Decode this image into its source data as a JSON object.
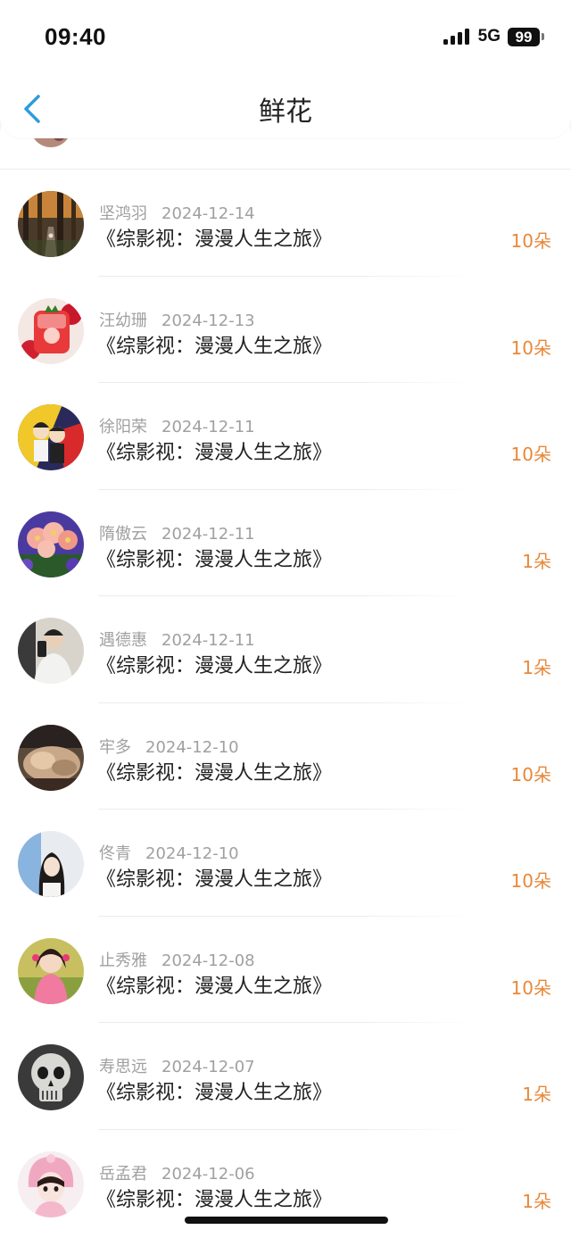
{
  "status_bar": {
    "time": "09:40",
    "network": "5G",
    "battery": "99"
  },
  "header": {
    "title": "鲜花",
    "back_icon": "chevron-left-icon",
    "accent_color": "#2d9cdb"
  },
  "colors": {
    "amount": "#e8883a",
    "meta": "#a0a0a0",
    "title": "#222222"
  },
  "records": [
    {
      "name": "坚鸿羽",
      "date": "2024-12-14",
      "book": "《综影视：漫漫人生之旅》",
      "amount": "10朵",
      "avatar": "forest-avatar"
    },
    {
      "name": "汪幼珊",
      "date": "2024-12-13",
      "book": "《综影视：漫漫人生之旅》",
      "amount": "10朵",
      "avatar": "strawberry-drink-avatar"
    },
    {
      "name": "徐阳荣",
      "date": "2024-12-11",
      "book": "《综影视：漫漫人生之旅》",
      "amount": "10朵",
      "avatar": "couple-cartoon-avatar"
    },
    {
      "name": "隋傲云",
      "date": "2024-12-11",
      "book": "《综影视：漫漫人生之旅》",
      "amount": "1朵",
      "avatar": "pink-flowers-avatar"
    },
    {
      "name": "遇德惠",
      "date": "2024-12-11",
      "book": "《综影视：漫漫人生之旅》",
      "amount": "1朵",
      "avatar": "mirror-selfie-avatar"
    },
    {
      "name": "牢多",
      "date": "2024-12-10",
      "book": "《综影视：漫漫人生之旅》",
      "amount": "10朵",
      "avatar": "sleeping-pet-avatar"
    },
    {
      "name": "佟青",
      "date": "2024-12-10",
      "book": "《综影视：漫漫人生之旅》",
      "amount": "10朵",
      "avatar": "girl-portrait-avatar"
    },
    {
      "name": "止秀雅",
      "date": "2024-12-08",
      "book": "《综影视：漫漫人生之旅》",
      "amount": "10朵",
      "avatar": "child-pink-avatar"
    },
    {
      "name": "寿思远",
      "date": "2024-12-07",
      "book": "《综影视：漫漫人生之旅》",
      "amount": "1朵",
      "avatar": "skull-avatar"
    },
    {
      "name": "岳孟君",
      "date": "2024-12-06",
      "book": "《综影视：漫漫人生之旅》",
      "amount": "1朵",
      "avatar": "anime-girl-avatar"
    }
  ]
}
